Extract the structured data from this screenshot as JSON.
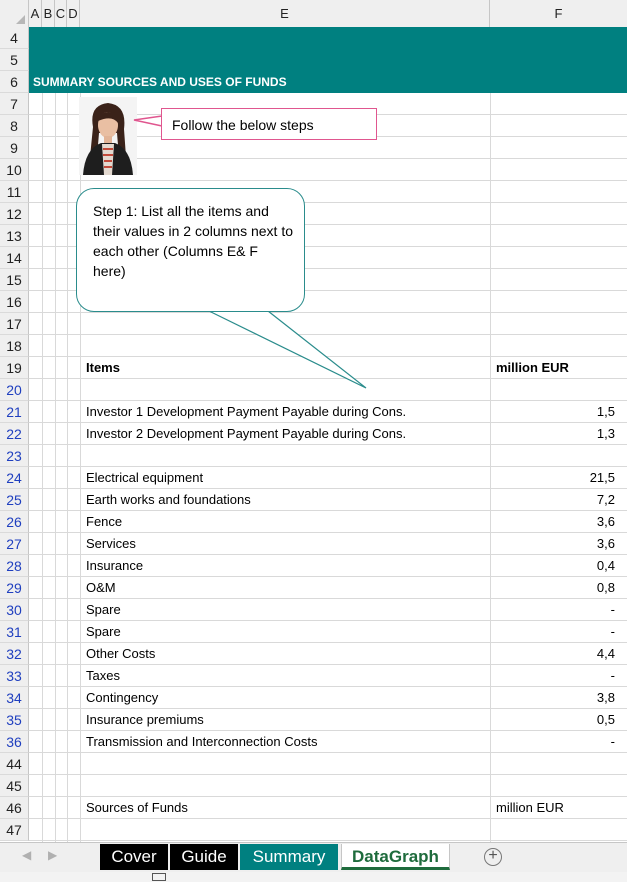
{
  "columns": [
    "A",
    "B",
    "C",
    "D",
    "E",
    "F"
  ],
  "banner_title": "SUMMARY SOURCES AND USES OF FUNDS",
  "callout_intro": "Follow the below steps",
  "callout_step1": "Step 1: List all the items and their values in 2 columns next to each other (Columns E& F here)",
  "header_row": {
    "item": "Items",
    "unit": "million EUR"
  },
  "rows": [
    {
      "num": "4",
      "link": false
    },
    {
      "num": "5",
      "link": false
    },
    {
      "num": "6",
      "link": false
    },
    {
      "num": "7",
      "link": false
    },
    {
      "num": "8",
      "link": false
    },
    {
      "num": "9",
      "link": false
    },
    {
      "num": "10",
      "link": false
    },
    {
      "num": "11",
      "link": false
    },
    {
      "num": "12",
      "link": false
    },
    {
      "num": "13",
      "link": false
    },
    {
      "num": "14",
      "link": false
    },
    {
      "num": "15",
      "link": false
    },
    {
      "num": "16",
      "link": false
    },
    {
      "num": "17",
      "link": false
    },
    {
      "num": "18",
      "link": false
    },
    {
      "num": "19",
      "link": false
    },
    {
      "num": "20",
      "link": true
    },
    {
      "num": "21",
      "link": true
    },
    {
      "num": "22",
      "link": true
    },
    {
      "num": "23",
      "link": true
    },
    {
      "num": "24",
      "link": true
    },
    {
      "num": "25",
      "link": true
    },
    {
      "num": "26",
      "link": true
    },
    {
      "num": "27",
      "link": true
    },
    {
      "num": "28",
      "link": true
    },
    {
      "num": "29",
      "link": true
    },
    {
      "num": "30",
      "link": true
    },
    {
      "num": "31",
      "link": true
    },
    {
      "num": "32",
      "link": true
    },
    {
      "num": "33",
      "link": true
    },
    {
      "num": "34",
      "link": true
    },
    {
      "num": "35",
      "link": true
    },
    {
      "num": "36",
      "link": true
    },
    {
      "num": "44",
      "link": false
    },
    {
      "num": "45",
      "link": false
    },
    {
      "num": "46",
      "link": false
    },
    {
      "num": "47",
      "link": false
    }
  ],
  "items": [
    {
      "label": "Investor 1 Development Payment Payable during Cons.",
      "value": "1,5"
    },
    {
      "label": "Investor 2 Development Payment Payable during Cons.",
      "value": "1,3"
    },
    {
      "label": "Electrical equipment",
      "value": "21,5"
    },
    {
      "label": "Earth works and foundations",
      "value": "7,2"
    },
    {
      "label": "Fence",
      "value": "3,6"
    },
    {
      "label": "Services",
      "value": "3,6"
    },
    {
      "label": "Insurance",
      "value": "0,4"
    },
    {
      "label": "O&M",
      "value": "0,8"
    },
    {
      "label": "Spare",
      "value": "-"
    },
    {
      "label": "Spare",
      "value": "-"
    },
    {
      "label": "Other Costs",
      "value": "4,4"
    },
    {
      "label": "Taxes",
      "value": "-"
    },
    {
      "label": "Contingency",
      "value": "3,8"
    },
    {
      "label": "Insurance premiums",
      "value": "0,5"
    },
    {
      "label": "Transmission and Interconnection Costs",
      "value": "-"
    }
  ],
  "sources_row": {
    "label": "Sources of Funds",
    "unit": "million EUR"
  },
  "tabs": {
    "cover": "Cover",
    "guide": "Guide",
    "summary": "Summary",
    "datagraph": "DataGraph"
  },
  "colors": {
    "teal": "#008080",
    "link_row_number": "#1f3fbf",
    "callout_border": "#e0568f",
    "active_tab": "#1e6b3c"
  },
  "icons": [
    "scroll-left-icon",
    "scroll-right-icon",
    "add-sheet-icon",
    "page-layout-icon"
  ]
}
